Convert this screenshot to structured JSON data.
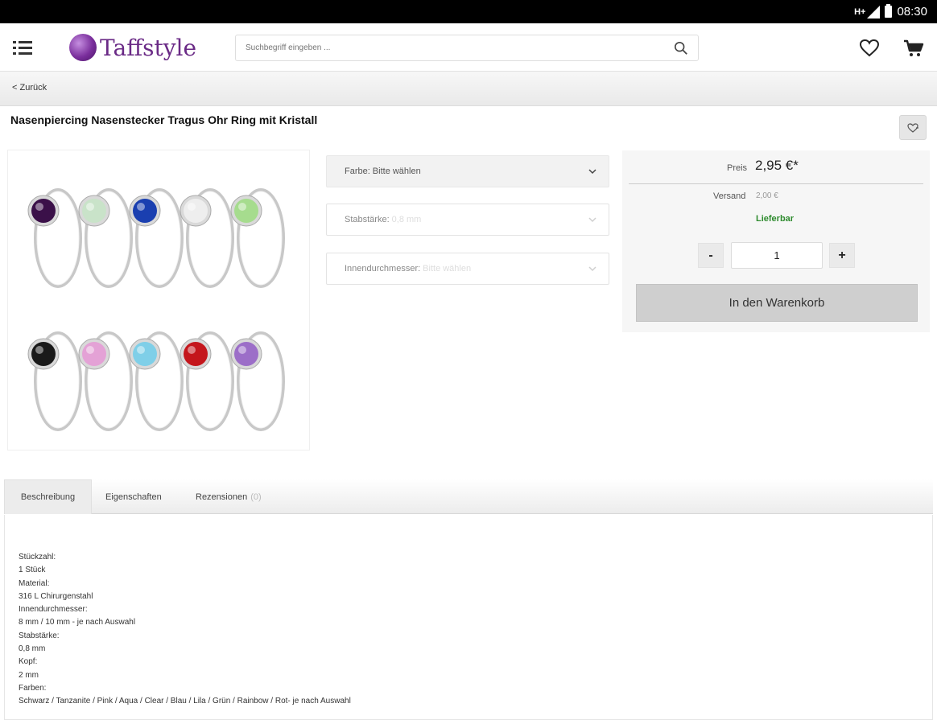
{
  "status_bar": {
    "network": "H+",
    "time": "08:30"
  },
  "header": {
    "logo_text": "Taffstyle",
    "search_placeholder": "Suchbegriff eingeben ..."
  },
  "back_label": "< Zurück",
  "product": {
    "title": "Nasenpiercing Nasenstecker Tragus Ohr Ring mit Kristall",
    "stone_colors_row1": [
      "#3b1049",
      "#c9e3c9",
      "#1a3fb0",
      "#eeeeee",
      "#a6dc8e"
    ],
    "stone_colors_row2": [
      "#1a1a1a",
      "#e4a2d6",
      "#7fcfe8",
      "#c4161c",
      "#9c6ec8"
    ]
  },
  "configurator": {
    "farbe_label": "Farbe:",
    "farbe_value": "Bitte wählen",
    "stab_label": "Stabstärke:",
    "stab_value": "0,8 mm",
    "innen_label": "Innendurchmesser:",
    "innen_value": "Bitte wählen"
  },
  "buy_box": {
    "price_label": "Preis",
    "price_value": "2,95 €*",
    "shipping_label": "Versand",
    "shipping_value": "2,00 €",
    "availability": "Lieferbar",
    "qty_minus": "-",
    "qty_value": "1",
    "qty_plus": "+",
    "cart_button": "In den Warenkorb",
    "availability_color": "#2e8b2e"
  },
  "tabs": [
    {
      "label": "Beschreibung"
    },
    {
      "label": "Eigenschaften"
    },
    {
      "label": "Rezensionen",
      "count": "(0)"
    }
  ],
  "description_lines": [
    "Stückzahl:",
    "1 Stück",
    "Material:",
    "316 L Chirurgenstahl",
    "Innendurchmesser:",
    "8 mm / 10 mm - je nach Auswahl",
    "Stabstärke:",
    "0,8 mm",
    "Kopf:",
    "2 mm",
    "Farben:",
    "Schwarz / Tanzanite / Pink / Aqua / Clear / Blau / Lila / Grün / Rainbow / Rot- je nach Auswahl"
  ]
}
